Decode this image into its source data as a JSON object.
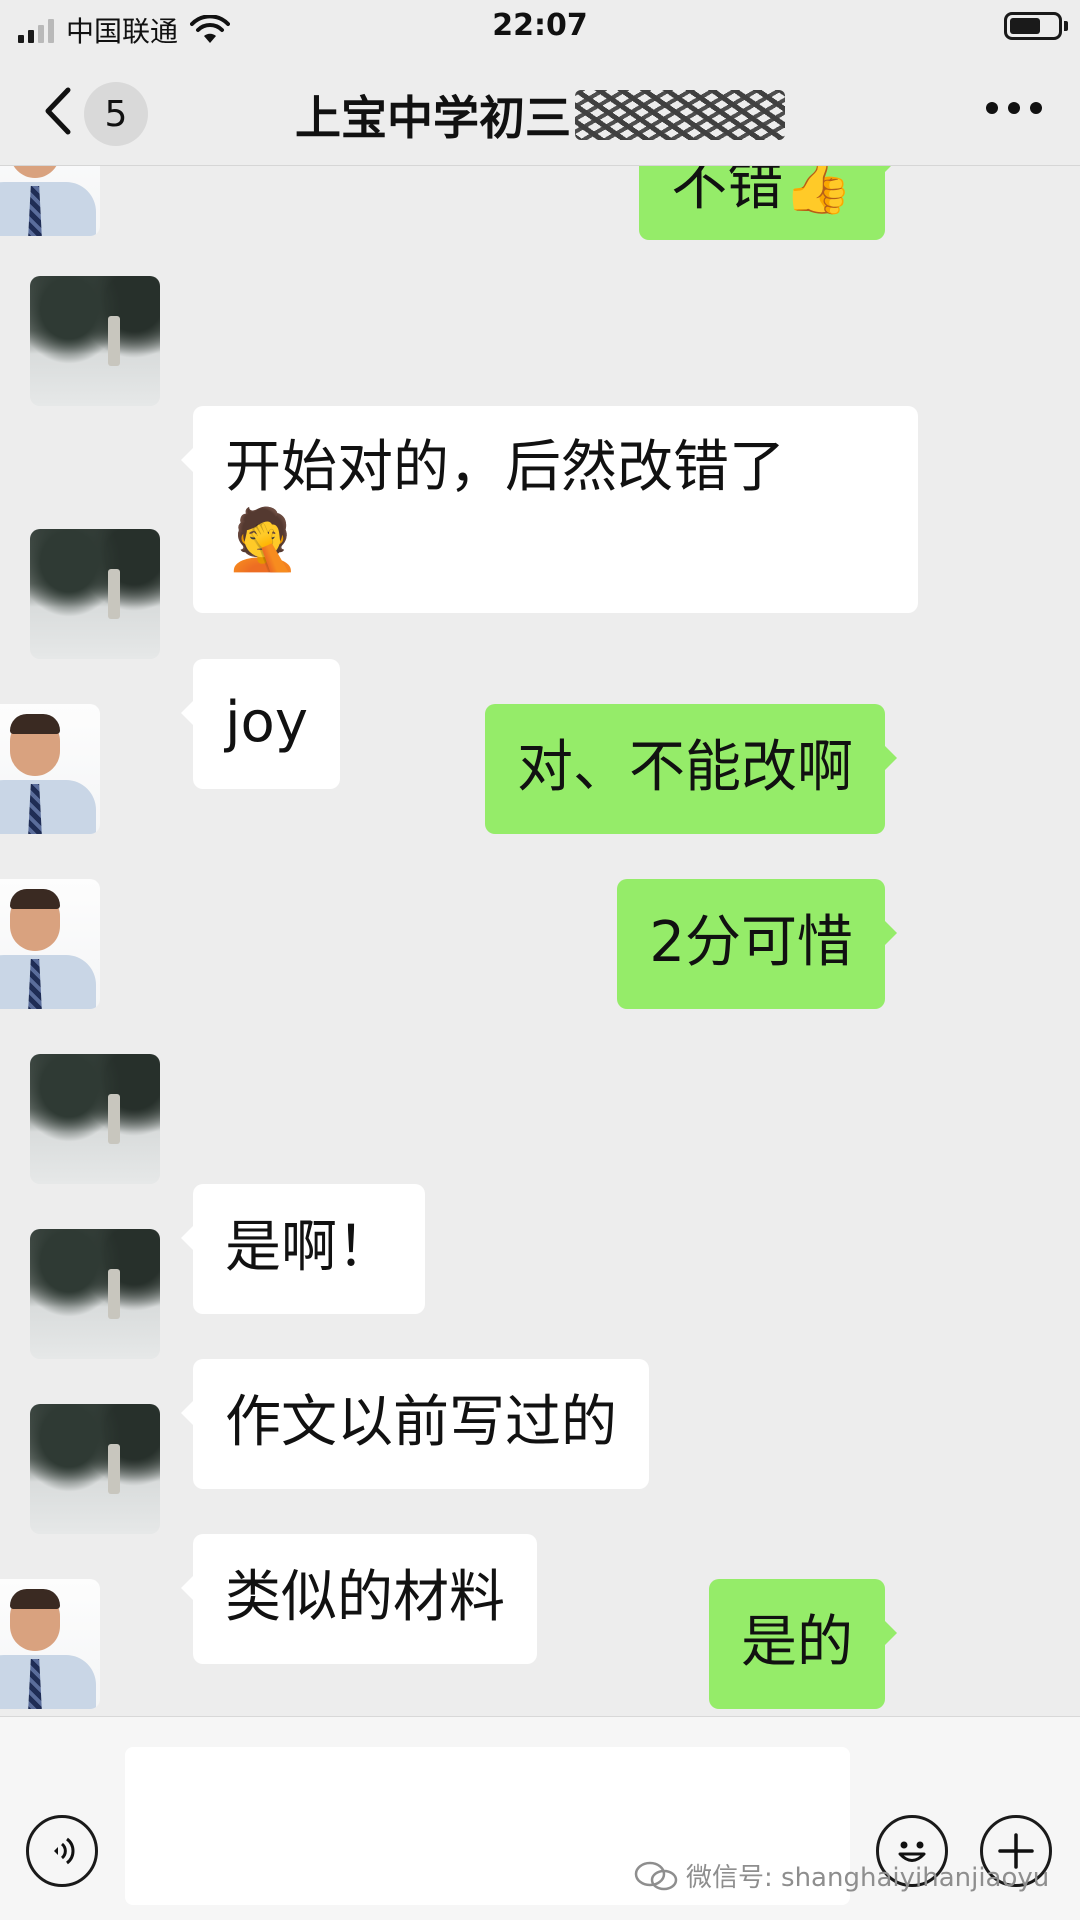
{
  "status_bar": {
    "carrier": "中国联通",
    "time": "22:07"
  },
  "nav": {
    "unread_count": "5",
    "title": "上宝中学初三"
  },
  "messages": [
    {
      "side": "right",
      "text": "不错👍",
      "partial": true
    },
    {
      "side": "left",
      "text": "开始对的，后然改错了",
      "emoji": "🤦"
    },
    {
      "side": "left",
      "text": "joy"
    },
    {
      "side": "right",
      "text": "对、不能改啊"
    },
    {
      "side": "right",
      "text": "2分可惜"
    },
    {
      "side": "left",
      "text": "是啊！"
    },
    {
      "side": "left",
      "text": "作文以前写过的"
    },
    {
      "side": "left",
      "text": "类似的材料"
    },
    {
      "side": "right",
      "text": "是的"
    }
  ],
  "input_bar": {
    "watermark": "微信号: shanghaiyihanjiaoyu"
  },
  "icons": [
    "back-chevron-icon",
    "more-dots-icon",
    "voice-icon",
    "emoji-icon",
    "plus-icon",
    "wechat-icon",
    "wifi-icon",
    "signal-icon",
    "battery-icon"
  ],
  "colors": {
    "background": "#ededed",
    "sent_bubble": "#95ec69",
    "received_bubble": "#ffffff"
  }
}
